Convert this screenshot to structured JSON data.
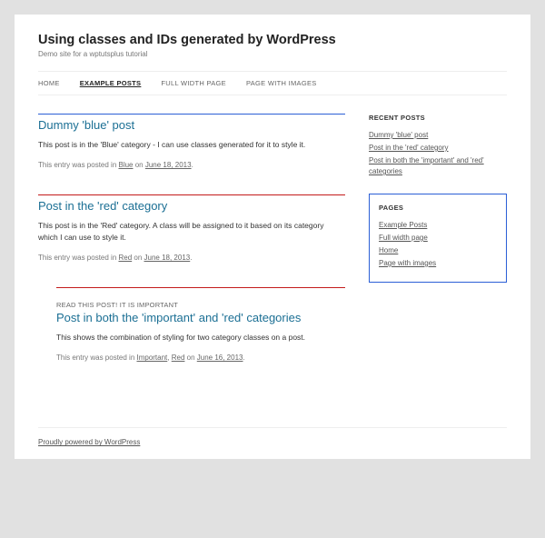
{
  "site": {
    "title": "Using classes and IDs generated by WordPress",
    "tagline": "Demo site for a wptutsplus tutorial"
  },
  "nav": [
    {
      "label": "HOME",
      "current": false
    },
    {
      "label": "EXAMPLE POSTS",
      "current": true
    },
    {
      "label": "FULL WIDTH PAGE",
      "current": false
    },
    {
      "label": "PAGE WITH IMAGES",
      "current": false
    }
  ],
  "posts": [
    {
      "rule_color": "blue",
      "important": false,
      "title": "Dummy 'blue' post",
      "excerpt": "This post is in the 'Blue' category - I can use classes generated for it to style it.",
      "meta_prefix": "This entry was posted in ",
      "cats": [
        "Blue"
      ],
      "meta_on": " on ",
      "date": "June 18, 2013"
    },
    {
      "rule_color": "red",
      "important": false,
      "title": "Post in the 'red' category",
      "excerpt": "This post is in the 'Red' category. A class will be assigned to it based on its category which I can use to style it.",
      "meta_prefix": "This entry was posted in ",
      "cats": [
        "Red"
      ],
      "meta_on": " on ",
      "date": "June 18, 2013"
    },
    {
      "rule_color": "red",
      "important": true,
      "important_label": "READ THIS POST! IT IS IMPORTANT",
      "title": "Post in both the 'important' and 'red' categories",
      "excerpt": "This shows the combination of styling for two category classes on a post.",
      "meta_prefix": "This entry was posted in ",
      "cats": [
        "Important",
        "Red"
      ],
      "meta_on": " on ",
      "date": "June 16, 2013"
    }
  ],
  "sidebar": {
    "recent": {
      "title": "RECENT POSTS",
      "items": [
        "Dummy 'blue' post",
        "Post in the 'red' category",
        "Post in both the 'important' and 'red' categories"
      ]
    },
    "pages": {
      "title": "PAGES",
      "items": [
        "Example Posts",
        "Full width page",
        "Home",
        "Page with images"
      ]
    }
  },
  "footer": {
    "credit": "Proudly powered by WordPress"
  }
}
